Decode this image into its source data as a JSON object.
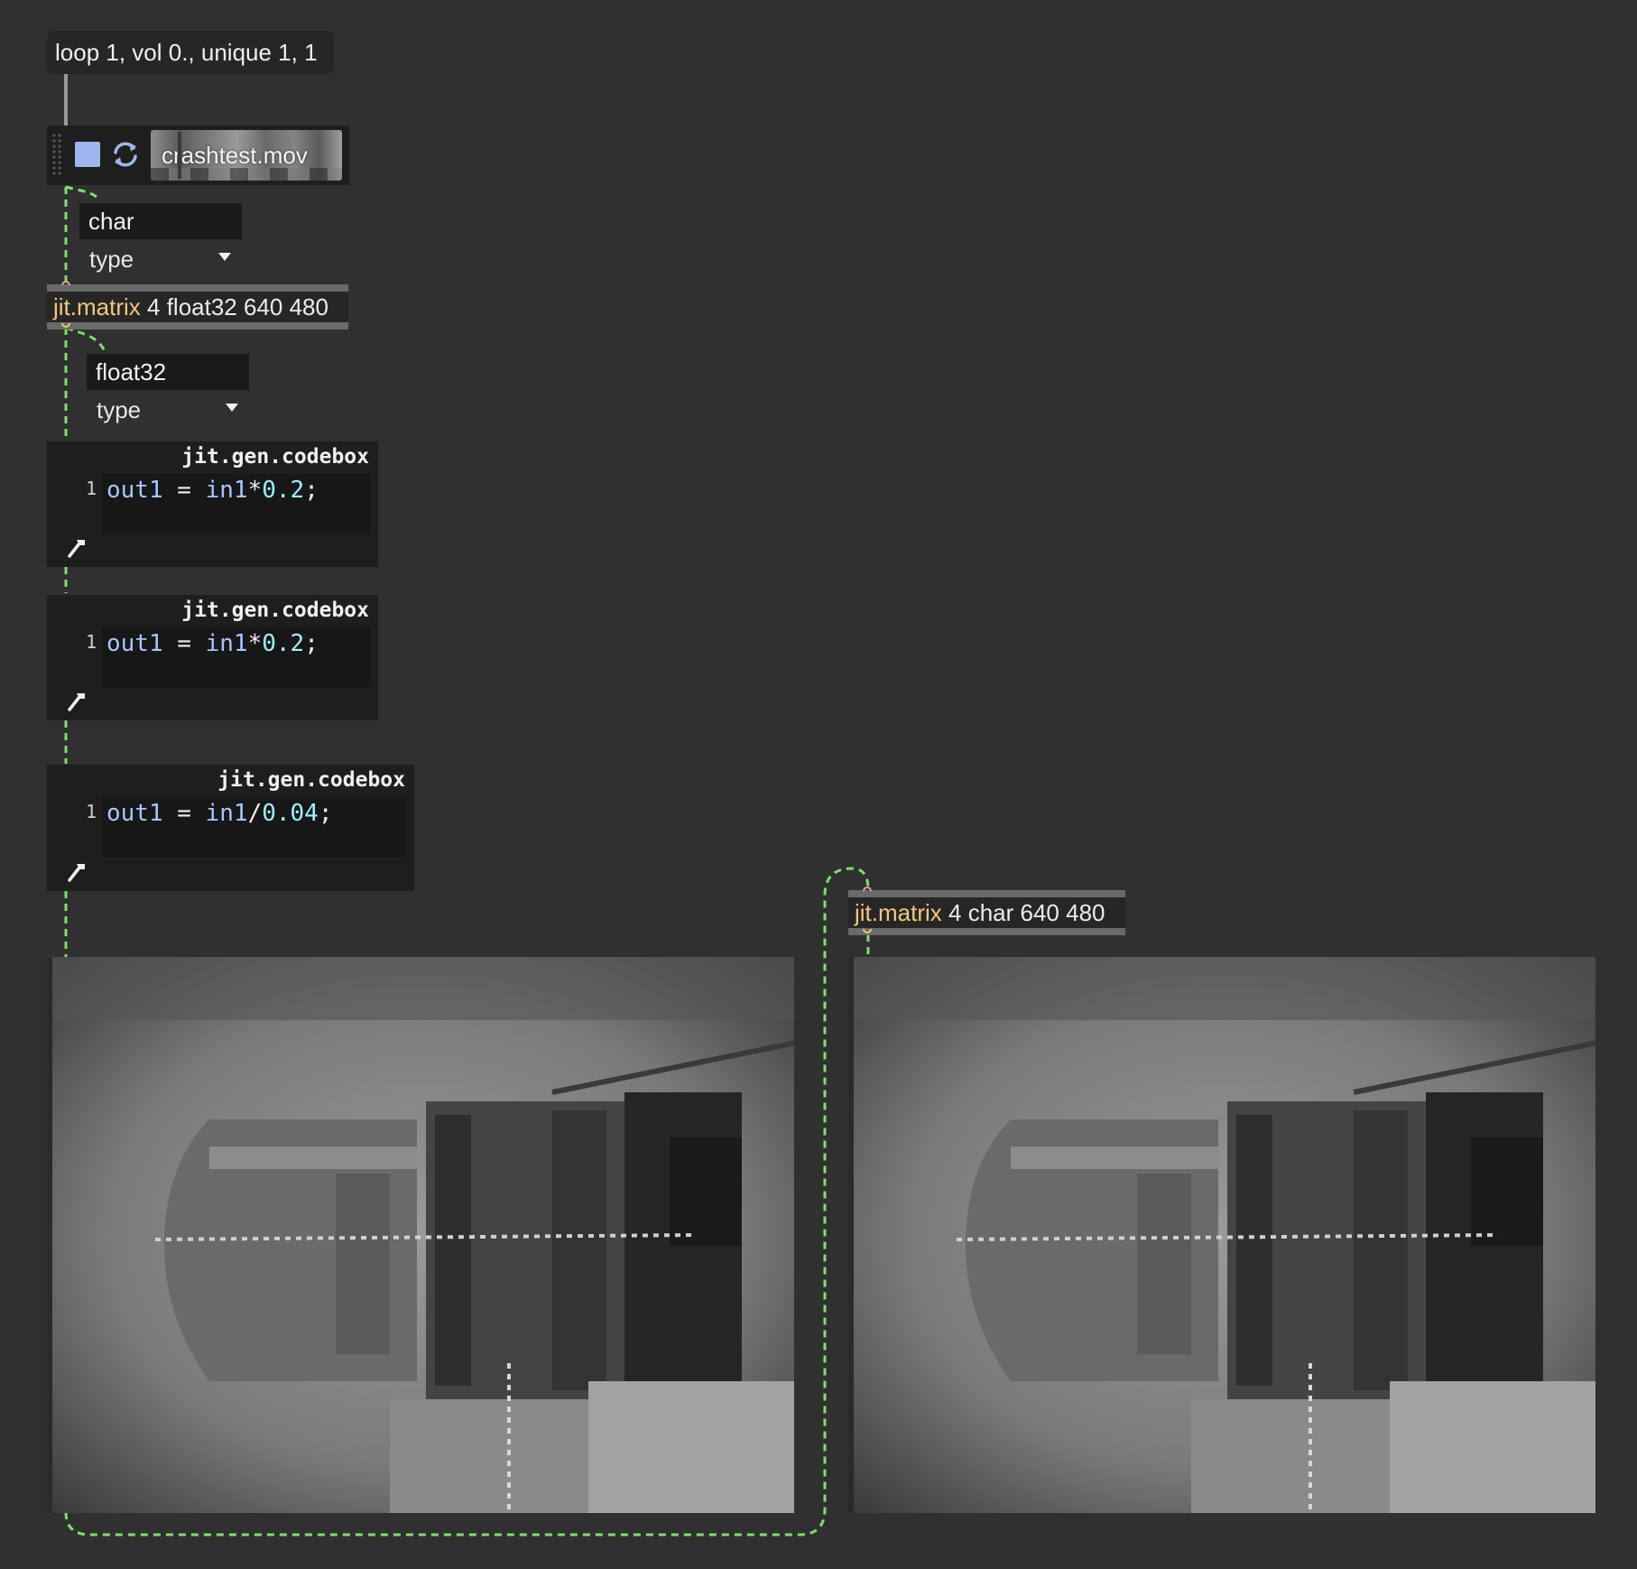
{
  "message_box": {
    "text": "loop 1, vol 0., unique 1, 1"
  },
  "movie_player": {
    "filename": "crashtest.mov",
    "stop_icon": "stop-square-icon",
    "loop_icon": "loop-arrows-icon"
  },
  "menus": [
    {
      "value": "char",
      "label": "type"
    },
    {
      "value": "float32",
      "label": "type"
    }
  ],
  "matrices": [
    {
      "class": "jit.matrix",
      "args": "4 float32 640 480"
    },
    {
      "class": "jit.matrix",
      "args": "4 char 640 480"
    }
  ],
  "codeboxes": [
    {
      "title": "jit.gen.codebox",
      "line_number": "1",
      "var": "out1",
      "eq": " = ",
      "input": "in1",
      "op": "*",
      "num": "0.2",
      "end": ";"
    },
    {
      "title": "jit.gen.codebox",
      "line_number": "1",
      "var": "out1",
      "eq": " = ",
      "input": "in1",
      "op": "*",
      "num": "0.2",
      "end": ";"
    },
    {
      "title": "jit.gen.codebox",
      "line_number": "1",
      "var": "out1",
      "eq": " = ",
      "input": "in1",
      "op": "/",
      "num": "0.04",
      "end": ";"
    }
  ],
  "colors": {
    "background": "#303030",
    "patch_cord_matrix": "#7ee06a",
    "object_class": "#f4c77a",
    "stop_button": "#9db6ee"
  }
}
